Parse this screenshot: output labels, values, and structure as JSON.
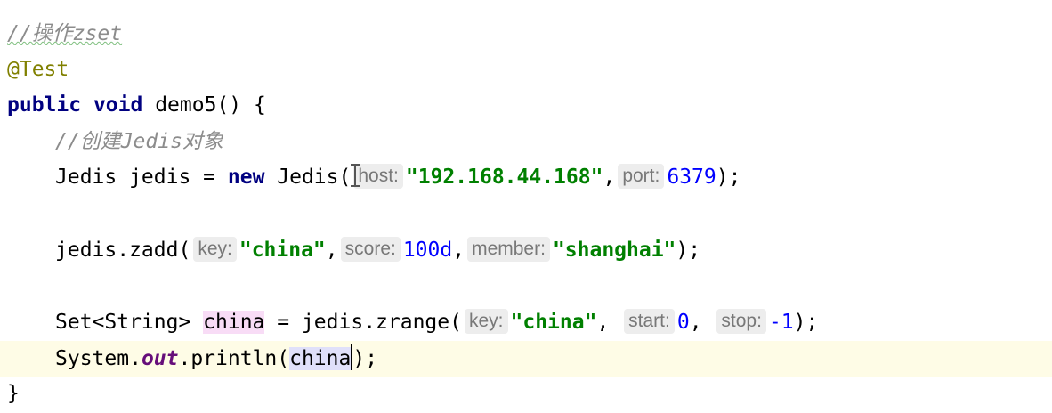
{
  "editor": {
    "line1": {
      "comment": "//操作zset"
    },
    "line2": {
      "annotation": "@Test"
    },
    "line3": {
      "kw_public": "public",
      "kw_void": "void",
      "method_sig": " demo5() {"
    },
    "line4": {
      "comment": "//创建Jedis对象"
    },
    "line5": {
      "decl": "Jedis jedis = ",
      "kw_new": "new",
      "call": " Jedis(",
      "hint_host": "host:",
      "host_value": "\"192.168.44.168\"",
      "comma": ",",
      "hint_port": "port:",
      "port_value": "6379",
      "end": ");"
    },
    "line7": {
      "call": "jedis.zadd(",
      "hint_key": "key:",
      "key_value": "\"china\"",
      "comma1": ",",
      "hint_score": "score:",
      "score_value": "100d",
      "comma2": ",",
      "hint_member": "member:",
      "member_value": "\"shanghai\"",
      "end": ");"
    },
    "line9": {
      "type": "Set<String> ",
      "var_name": "china",
      "assign": " = jedis.zrange(",
      "hint_key": "key:",
      "key_value": "\"china\"",
      "comma1": ", ",
      "hint_start": "start:",
      "start_value": "0",
      "comma2": ", ",
      "hint_stop": "stop:",
      "stop_value": "-1",
      "end": ");"
    },
    "line10": {
      "prefix": "System.",
      "field_out": "out",
      "call": ".println(",
      "arg": "china",
      "end": ");"
    },
    "line11": {
      "brace": "}"
    }
  }
}
